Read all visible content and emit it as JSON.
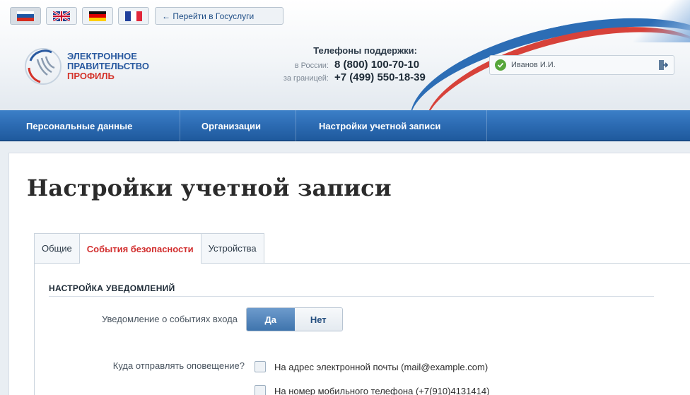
{
  "header": {
    "languages": [
      {
        "name": "ru-flag",
        "active": true
      },
      {
        "name": "en-flag",
        "active": false
      },
      {
        "name": "de-flag",
        "active": false
      },
      {
        "name": "fr-flag",
        "active": false
      }
    ],
    "gosuslugi_link": "← Перейти в Госуслуги",
    "logo": {
      "line1": "ЭЛЕКТРОННОЕ",
      "line2": "ПРАВИТЕЛЬСТВО",
      "line3": "ПРОФИЛЬ"
    },
    "support": {
      "title": "Телефоны поддержки:",
      "russia_label": "в России:",
      "russia_number": "8 (800) 100-70-10",
      "abroad_label": "за границей:",
      "abroad_number": "+7 (499) 550-18-39"
    },
    "user": {
      "name": "Иванов И.И.",
      "status_color": "#56a63a"
    }
  },
  "nav": {
    "items": [
      {
        "label": "Персональные данные"
      },
      {
        "label": "Организации"
      },
      {
        "label": "Настройки учетной записи"
      }
    ]
  },
  "main": {
    "title": "Настройки учетной записи",
    "tabs": [
      {
        "label": "Общие",
        "active": false
      },
      {
        "label": "События безопасности",
        "active": true
      },
      {
        "label": "Устройства",
        "active": false
      }
    ],
    "section_title": "НАСТРОЙКА УВЕДОМЛЕНИЙ",
    "login_notify": {
      "label": "Уведомление о событиях входа",
      "yes": "Да",
      "no": "Нет",
      "selected": "Да"
    },
    "send_to": {
      "label": "Куда отправлять оповещение?",
      "options": [
        {
          "label": "На адрес электронной почты (mail@example.com)",
          "checked": false
        },
        {
          "label": "На номер мобильного телефона (+7(910)4131414)",
          "checked": false
        }
      ]
    }
  },
  "colors": {
    "nav_blue": "#2c6bb3",
    "accent_red": "#d22e2e",
    "toggle_active": "#4a7eb6"
  }
}
